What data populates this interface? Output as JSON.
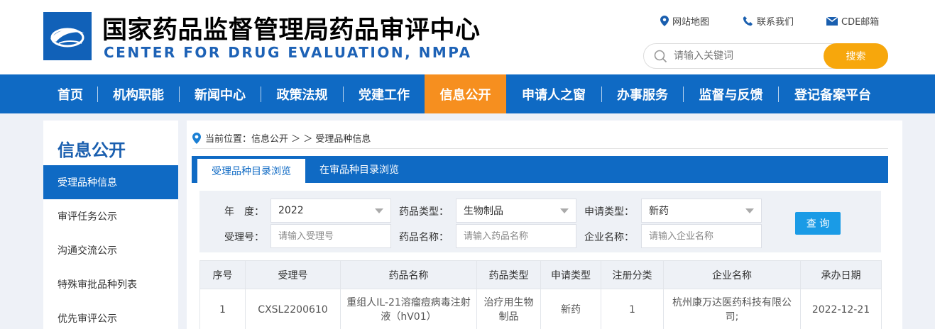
{
  "header": {
    "title_cn": "国家药品监督管理局药品审评中心",
    "title_en": "CENTER FOR DRUG EVALUATION, NMPA",
    "links": [
      {
        "label": "网站地图",
        "icon": "location-pin-icon"
      },
      {
        "label": "联系我们",
        "icon": "phone-icon"
      },
      {
        "label": "CDE邮箱",
        "icon": "mail-icon"
      }
    ],
    "search": {
      "placeholder": "请输入关键词",
      "button": "搜索"
    }
  },
  "nav": {
    "items": [
      "首页",
      "机构职能",
      "新闻中心",
      "政策法规",
      "党建工作",
      "信息公开",
      "申请人之窗",
      "办事服务",
      "监督与反馈",
      "登记备案平台"
    ],
    "active": "信息公开"
  },
  "sidebar": {
    "title": "信息公开",
    "items": [
      "受理品种信息",
      "审评任务公示",
      "沟通交流公示",
      "特殊审批品种列表",
      "优先审评公示"
    ]
  },
  "breadcrumb": {
    "text": "当前位置：信息公开 ＞ ＞ 受理品种信息"
  },
  "tabs": [
    "受理品种目录浏览",
    "在审品种目录浏览"
  ],
  "filter": {
    "year_label": "年　度：",
    "year_value": "2022",
    "drug_type_label": "药品类型：",
    "drug_type_value": "生物制品",
    "apply_type_label": "申请类型：",
    "apply_type_value": "新药",
    "accept_no_label": "受理号：",
    "accept_no_placeholder": "请输入受理号",
    "drug_name_label": "药品名称：",
    "drug_name_placeholder": "请输入药品名称",
    "company_label": "企业名称：",
    "company_placeholder": "请输入企业名称",
    "query_button": "查 询"
  },
  "table": {
    "columns": [
      "序号",
      "受理号",
      "药品名称",
      "药品类型",
      "申请类型",
      "注册分类",
      "企业名称",
      "承办日期"
    ],
    "rows": [
      [
        "1",
        "CXSL2200610",
        "重组人IL-21溶瘤痘病毒注射液（hV01）",
        "治疗用生物制品",
        "新药",
        "1",
        "杭州康万达医药科技有限公司;",
        "2022-12-21"
      ]
    ]
  },
  "colors": {
    "primary": "#0f6ac4",
    "accent": "#f68f1f",
    "search_button": "#f7a70c",
    "query_button": "#1a9be6"
  }
}
